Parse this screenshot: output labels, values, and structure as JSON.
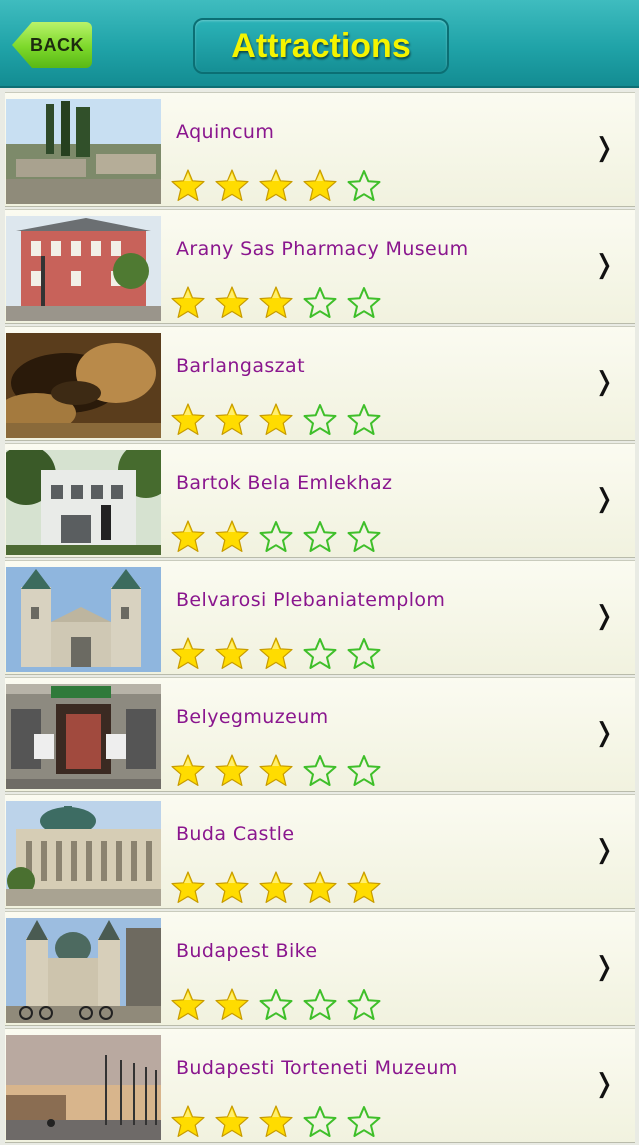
{
  "header": {
    "back_label": "BACK",
    "title": "Attractions"
  },
  "chevron": "❭",
  "colors": {
    "header": "#20a3a8",
    "back_button": "#7cd82a",
    "title_text": "#f4f400",
    "item_text": "#8a168e",
    "star_filled": "#ffdc00",
    "star_outline": "#3fbf2a"
  },
  "items": [
    {
      "name": "Aquincum",
      "rating": 4,
      "thumb": "ruins-icon"
    },
    {
      "name": "Arany Sas Pharmacy Museum",
      "rating": 3,
      "thumb": "building-icon"
    },
    {
      "name": "Barlangaszat",
      "rating": 3,
      "thumb": "cave-icon"
    },
    {
      "name": "Bartok Bela Emlekhaz",
      "rating": 2,
      "thumb": "house-icon"
    },
    {
      "name": "Belvarosi Plebaniatemplom",
      "rating": 3,
      "thumb": "church-icon"
    },
    {
      "name": "Belyegmuzeum",
      "rating": 3,
      "thumb": "museum-icon"
    },
    {
      "name": "Buda Castle",
      "rating": 5,
      "thumb": "castle-icon"
    },
    {
      "name": "Budapest Bike",
      "rating": 2,
      "thumb": "basilica-icon"
    },
    {
      "name": "Budapesti Torteneti Muzeum",
      "rating": 3,
      "thumb": "promenade-icon"
    }
  ]
}
